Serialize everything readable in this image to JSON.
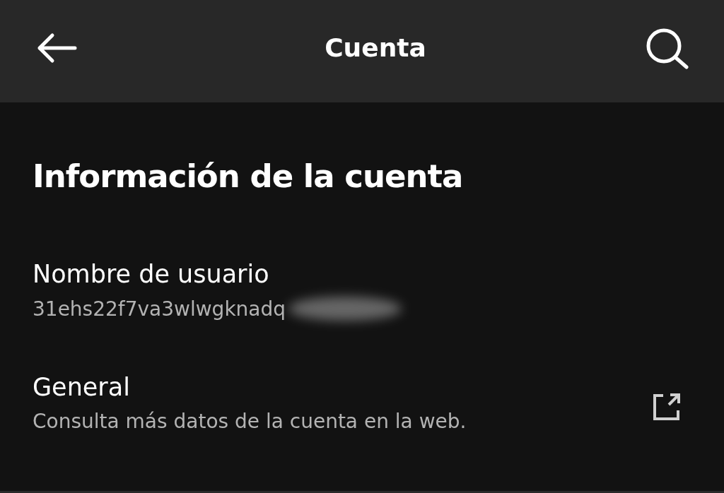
{
  "header": {
    "title": "Cuenta"
  },
  "section": {
    "title": "Información de la cuenta"
  },
  "items": [
    {
      "kind": "info",
      "label": "Nombre de usuario",
      "value": "31ehs22f7va3wlwgknadq",
      "redacted": true
    },
    {
      "kind": "link",
      "label": "General",
      "value": "Consulta más datos de la cuenta en la web.",
      "redacted": false
    }
  ]
}
